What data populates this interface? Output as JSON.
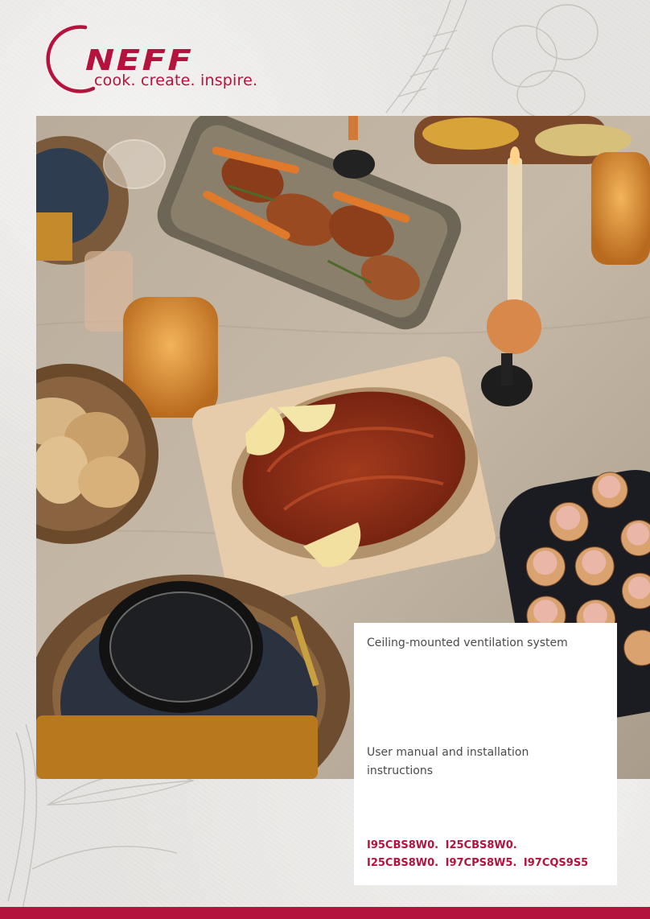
{
  "brand": {
    "name": "NEFF",
    "tagline": "cook. create. inspire.",
    "color": "#b5123d"
  },
  "document": {
    "title": "Ceiling-mounted ventilation system",
    "subtitle": "User manual and installation instructions",
    "models_line1": "I95CBS8W0.   I25CBS8W0.",
    "models_line2": "I25CBS8W0.   I97CPS8W5.   I97CQS9S5"
  },
  "icons": {
    "logo": "neff-arc-logo",
    "cover_photo": "dinner-table-photo",
    "sketches": "botanical-vegetable-sketches"
  },
  "colors": {
    "accent": "#b5123d",
    "bottom_bar": "#b3133c",
    "panel_bg": "#ffffff",
    "text": "#4a4a4a"
  }
}
